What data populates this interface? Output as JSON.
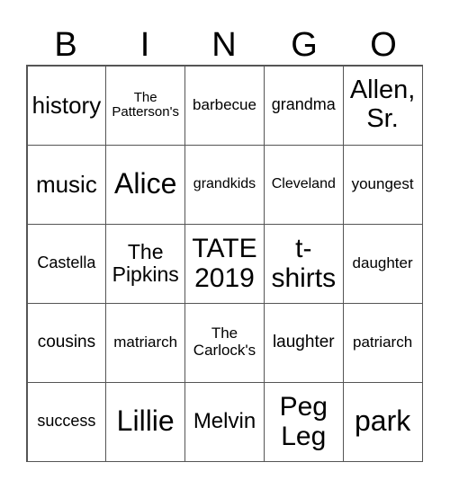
{
  "header": [
    "B",
    "I",
    "N",
    "G",
    "O"
  ],
  "cells": [
    [
      "history",
      "The\nPatterson's",
      "barbecue",
      "grandma",
      "Allen,\nSr."
    ],
    [
      "music",
      "Alice",
      "grandkids",
      "Cleveland",
      "youngest"
    ],
    [
      "Castella",
      "The\nPipkins",
      "TATE\n2019",
      "t-\nshirts",
      "daughter"
    ],
    [
      "cousins",
      "matriarch",
      "The\nCarlock's",
      "laughter",
      "patriarch"
    ],
    [
      "success",
      "Lillie",
      "Melvin",
      "Peg\nLeg",
      "park"
    ]
  ]
}
